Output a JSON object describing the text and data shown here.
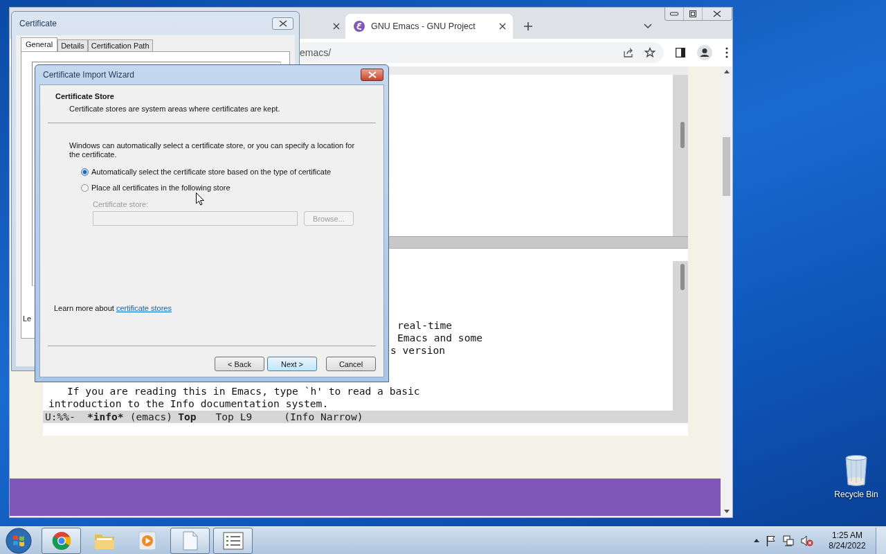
{
  "browser": {
    "tabs": [
      {
        "selected": false
      },
      {
        "title": "GNU Emacs - GNU Project",
        "selected": true
      }
    ],
    "address": "emacs/",
    "emacs": {
      "paragraphs": [
        [
          "real-time",
          "Emacs and some",
          "s version"
        ],
        [
          "If you are reading this in Emacs, type `h' to read a basic",
          "introduction to the Info documentation system."
        ]
      ],
      "mode_line": [
        {
          "text": "U:%%-",
          "bold": false
        },
        {
          "text": "*info*",
          "bold": true
        },
        {
          "text": "(emacs)",
          "bold": false
        },
        {
          "text": "Top",
          "bold": true
        },
        {
          "text": "Top L9",
          "bold": false
        },
        {
          "text": "(Info Narrow)",
          "bold": false
        }
      ]
    }
  },
  "certificate_dialog": {
    "title": "Certificate",
    "tabs": [
      {
        "label": "General",
        "selected": true
      },
      {
        "label": "Details",
        "selected": false
      },
      {
        "label": "Certification Path",
        "selected": false
      }
    ],
    "partial_text": "Le"
  },
  "wizard": {
    "title": "Certificate Import Wizard",
    "heading": "Certificate Store",
    "subheading": "Certificate stores are system areas where certificates are kept.",
    "intro": "Windows can automatically select a certificate store, or you can specify a location for the certificate.",
    "options": [
      {
        "label": "Automatically select the certificate store based on the type of certificate",
        "selected": true
      },
      {
        "label": "Place all certificates in the following store",
        "selected": false
      }
    ],
    "store_field": {
      "label": "Certificate store:",
      "disabled": true
    },
    "browse": {
      "label": "Browse...",
      "disabled": true
    },
    "learn_prefix": "Learn more about",
    "learn_link": "certificate stores",
    "buttons": [
      {
        "label": "< Back",
        "focused": false
      },
      {
        "label": "Next >",
        "focused": true
      },
      {
        "label": "Cancel",
        "focused": false
      }
    ]
  },
  "taskbar": {
    "apps": [
      {
        "kind": "chrome",
        "open": true
      },
      {
        "kind": "folder",
        "open": false
      },
      {
        "kind": "media",
        "open": false
      },
      {
        "kind": "document",
        "open": true
      },
      {
        "kind": "list",
        "open": true
      }
    ],
    "time": "1:25 AM",
    "date": "8/24/2022"
  },
  "desktop_icons": [
    {
      "label": "Recycle Bin"
    }
  ]
}
